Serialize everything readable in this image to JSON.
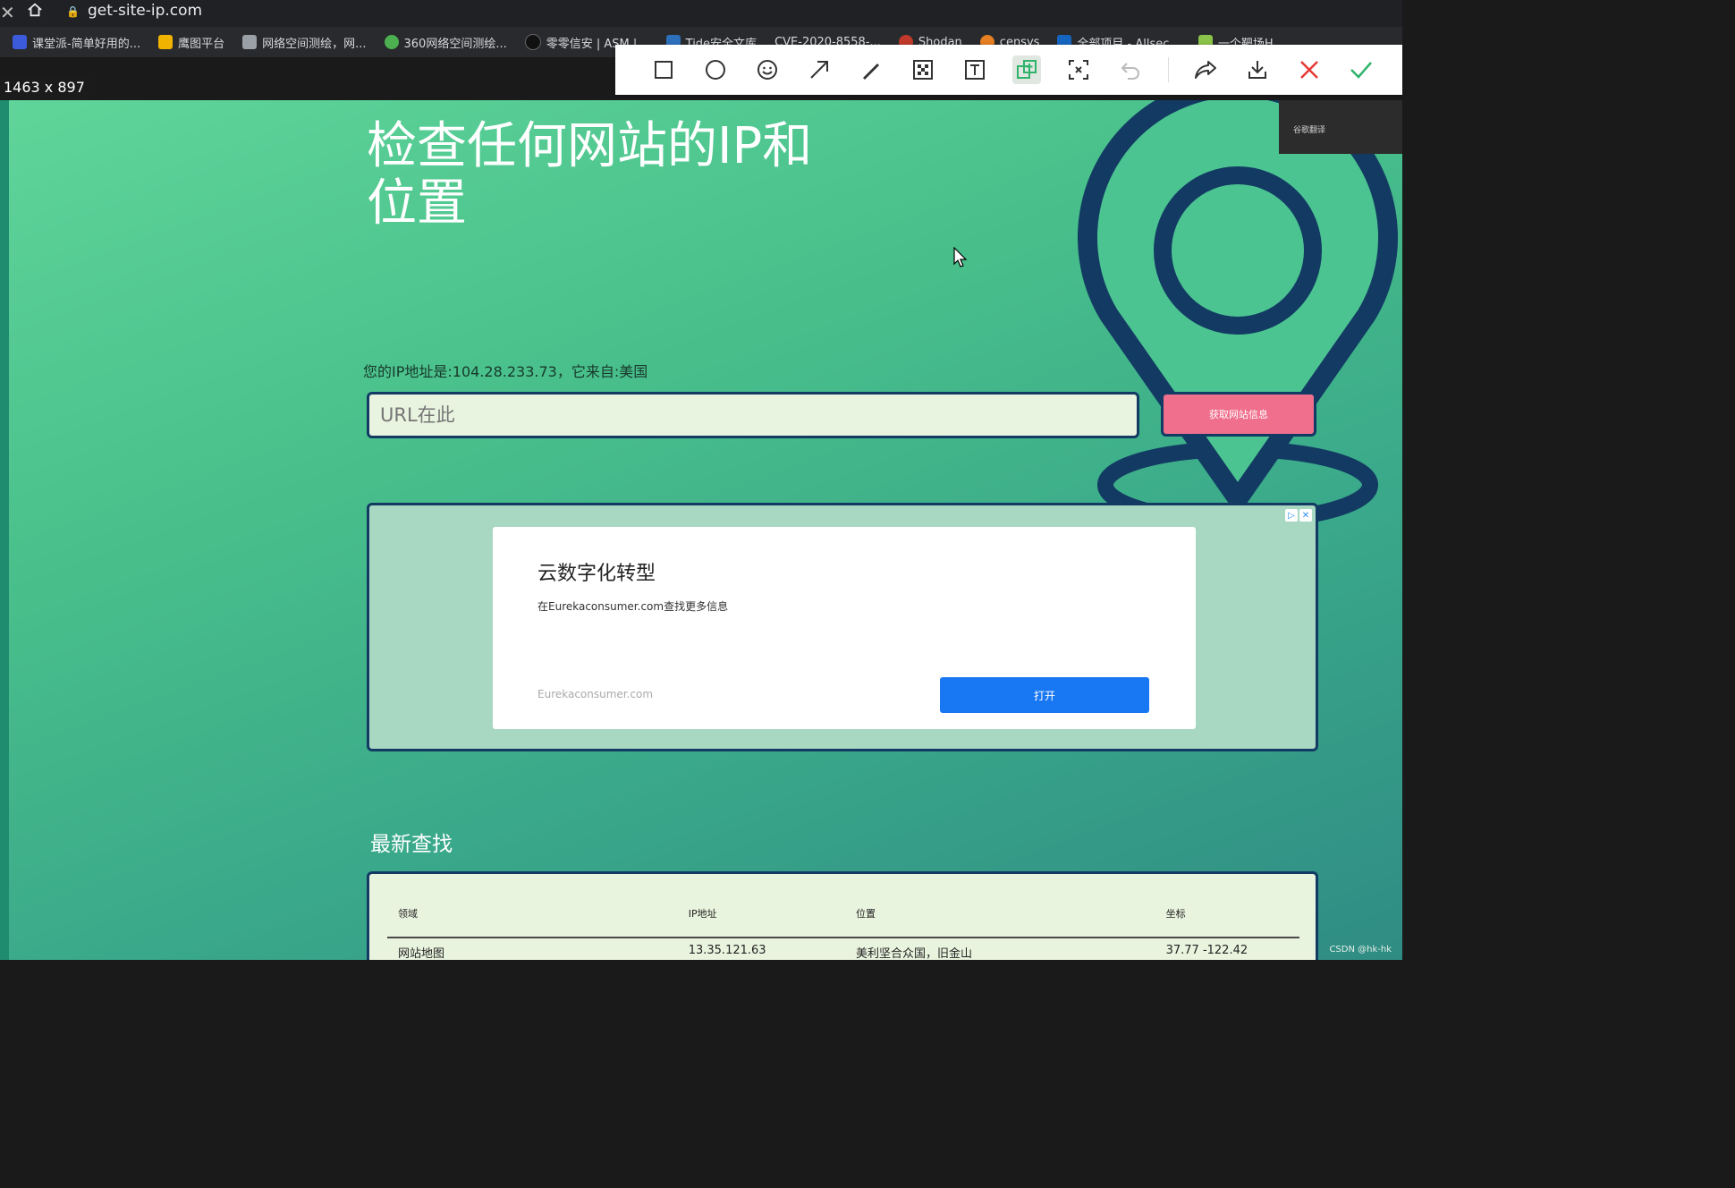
{
  "browser": {
    "url": "get-site-ip.com",
    "bookmarks": [
      {
        "label": "课堂派-简单好用的...",
        "color": "#3b5bdb"
      },
      {
        "label": "鹰图平台",
        "color": "#f0b400"
      },
      {
        "label": "网络空间测绘，网...",
        "color": "#9aa0a6"
      },
      {
        "label": "360网络空间测绘...",
        "color": "#4caf50"
      },
      {
        "label": "零零信安 | ASM |...",
        "color": "#111111"
      },
      {
        "label": "Tide安全文库",
        "color": "#2c6fbb"
      },
      {
        "label": "CVE-2020-8558-...",
        "color": "#888888"
      },
      {
        "label": "Shodan",
        "color": "#c0392b"
      },
      {
        "label": "censys",
        "color": "#e67e22"
      },
      {
        "label": "全部项目 - Allsec...",
        "color": "#1565c0"
      },
      {
        "label": "一个靶场H",
        "color": "#8bc34a"
      }
    ]
  },
  "screenshot_tool": {
    "size_label": "1463 x 897",
    "tools": [
      "rectangle-icon",
      "circle-icon",
      "emoji-icon",
      "arrow-icon",
      "pen-icon",
      "mosaic-icon",
      "text-icon",
      "pin-to-screen-icon",
      "ocr-icon",
      "undo-icon",
      "share-icon",
      "download-icon",
      "close-icon",
      "confirm-icon"
    ]
  },
  "side_overlay": {
    "label": "谷歌翻译"
  },
  "hero": {
    "title_line1": "检查任何网站的IP和",
    "title_line2": "位置"
  },
  "ip_info": "您的IP地址是:104.28.233.73，它来自:美国",
  "search": {
    "placeholder": "URL在此",
    "button_label": "获取网站信息"
  },
  "ad": {
    "title": "云数字化转型",
    "description": "在Eurekaconsumer.com查找更多信息",
    "domain": "Eurekaconsumer.com",
    "button_label": "打开"
  },
  "recent": {
    "title": "最新查找",
    "headers": [
      "领域",
      "IP地址",
      "位置",
      "坐标"
    ],
    "rows": [
      [
        "网站地图",
        "13.35.121.63",
        "美利坚合众国，旧金山",
        "37.77 -122.42"
      ]
    ]
  },
  "watermark": "CSDN @hk-hk",
  "colors": {
    "accent_pink": "#ef6f8d",
    "navy": "#123a63",
    "ad_button": "#1877f2",
    "confirm_green": "#2fb36b",
    "close_red": "#e53935"
  }
}
